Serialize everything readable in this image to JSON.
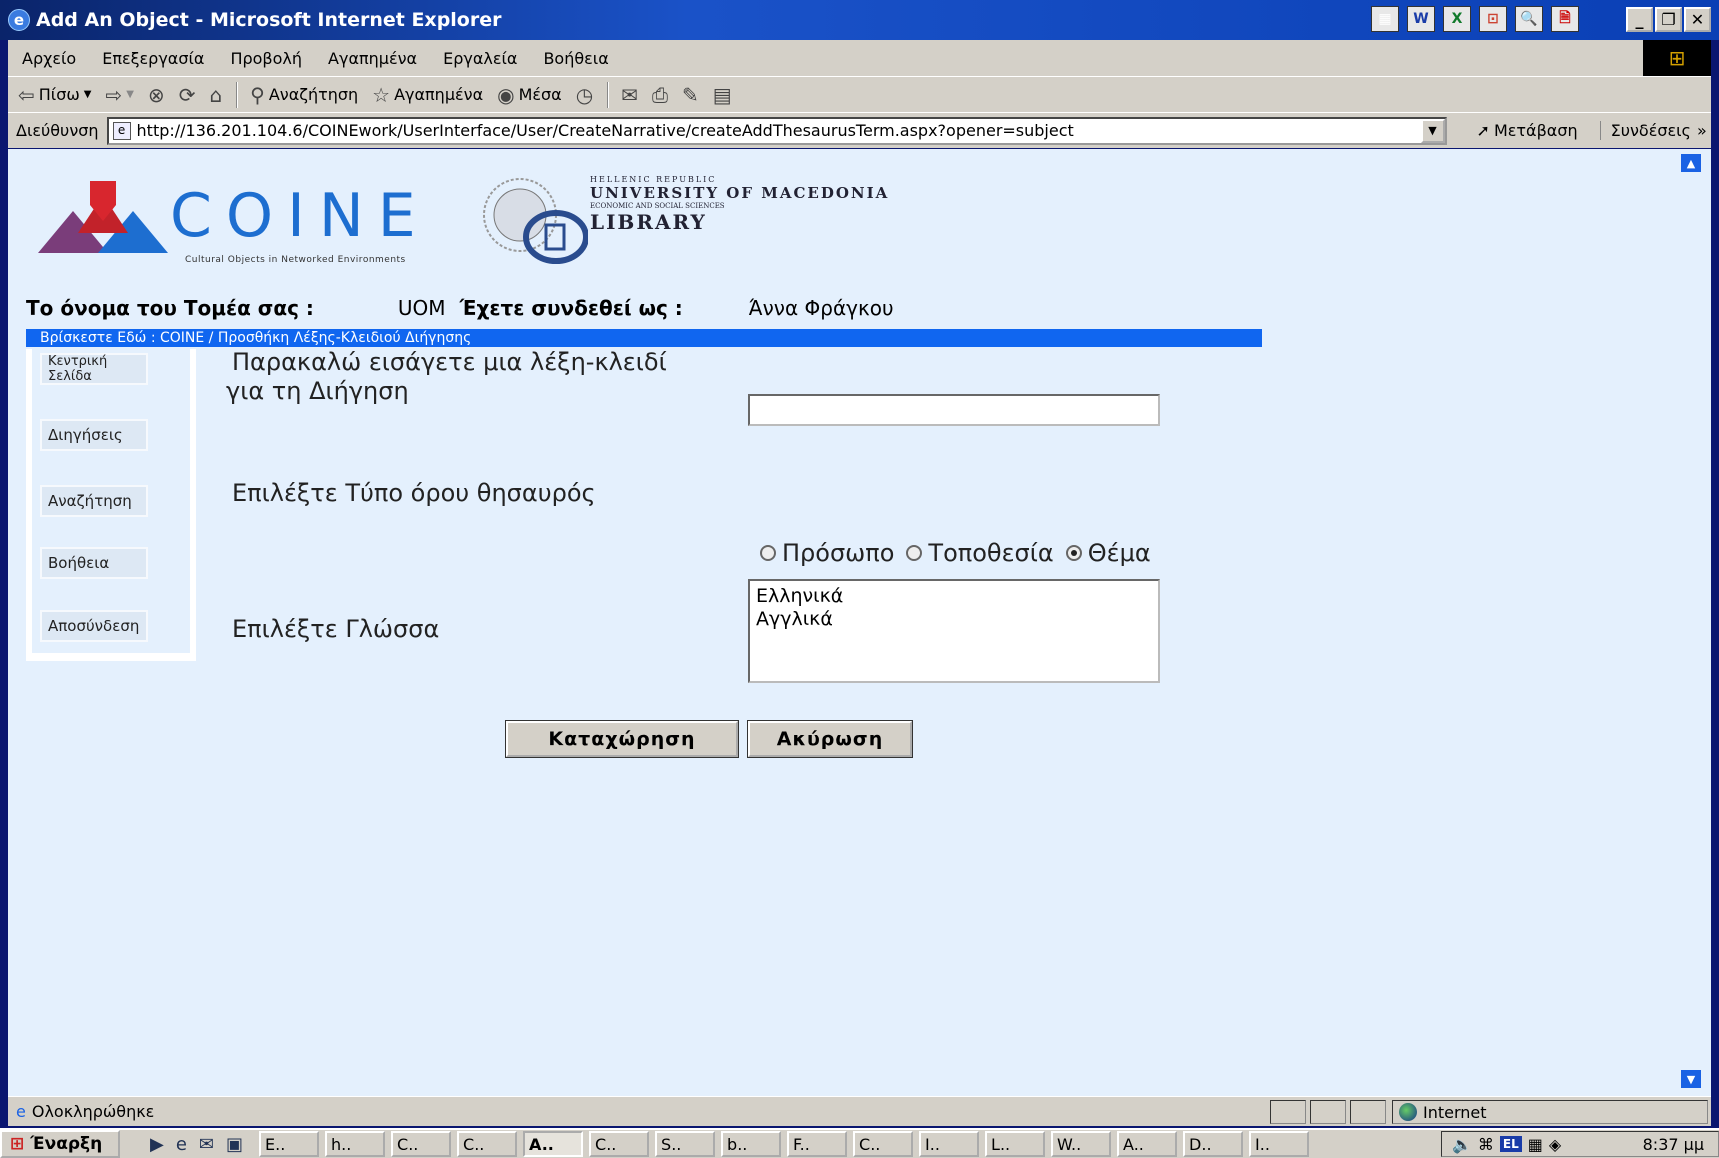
{
  "window": {
    "title": "Add An Object - Microsoft Internet Explorer",
    "app_buttons": [
      "▦",
      "W",
      "X",
      "⊡",
      "🔍",
      "🗎"
    ],
    "controls": [
      "_",
      "❐",
      "✕"
    ]
  },
  "menubar": {
    "items": [
      "Αρχείο",
      "Επεξεργασία",
      "Προβολή",
      "Αγαπημένα",
      "Εργαλεία",
      "Βοήθεια"
    ]
  },
  "toolbar": {
    "back": "Πίσω",
    "search": "Αναζήτηση",
    "favorites": "Αγαπημένα",
    "media": "Μέσα"
  },
  "addressbar": {
    "label": "Διεύθυνση",
    "url": "http://136.201.104.6/COINEwork/UserInterface/User/CreateNarrative/createAddThesaurusTerm.aspx?opener=subject",
    "go": "Μετάβαση",
    "links": "Συνδέσεις",
    "links_more": "»"
  },
  "header": {
    "logo_text": "COINE",
    "logo_subtitle": "Cultural Objects in Networked Environments",
    "university_line1": "HELLENIC REPUBLIC",
    "university_line2": "UNIVERSITY OF MACEDONIA",
    "university_line3": "ECONOMIC AND SOCIAL SCIENCES",
    "university_line4": "LIBRARY"
  },
  "info": {
    "domain_label": "Το όνομα του Τομέα σας :",
    "domain_value": "UOM",
    "user_label": "Έχετε συνδεθεί ως :",
    "user_value": "Άννα Φράγκου"
  },
  "breadcrumb": "Βρίσκεστε Εδώ : COINE / Προσθήκη Λέξης-Κλειδιού Διήγησης",
  "sidebar": {
    "items": [
      "Κεντρική Σελίδα",
      "Διηγήσεις",
      "Αναζήτηση",
      "Βοήθεια",
      "Αποσύνδεση"
    ]
  },
  "form": {
    "keyword_label_line1": "Παρακαλώ εισάγετε μια λέξη-κλειδί",
    "keyword_label_line2": "για τη Διήγηση",
    "keyword_value": "",
    "type_label": "Επιλέξτε Τύπο όρου θησαυρός",
    "type_options": [
      "Πρόσωπο",
      "Τοποθεσία",
      "Θέμα"
    ],
    "type_selected": "Θέμα",
    "language_label": "Επιλέξτε Γλώσσα",
    "language_options": [
      "Ελληνικά",
      "Αγγλικά"
    ],
    "submit": "Καταχώρηση",
    "cancel": "Ακύρωση"
  },
  "statusbar": {
    "status": "Ολοκληρώθηκε",
    "zone": "Internet"
  },
  "taskbar": {
    "start": "Έναρξη",
    "tasks": [
      "E..",
      "h..",
      "C..",
      "C..",
      "A..",
      "C..",
      "S..",
      "b..",
      "F..",
      "C..",
      "I..",
      "L..",
      "W..",
      "A..",
      "D..",
      "I.."
    ],
    "active_task": "A..",
    "language": "EL",
    "clock": "8:37 μμ"
  }
}
